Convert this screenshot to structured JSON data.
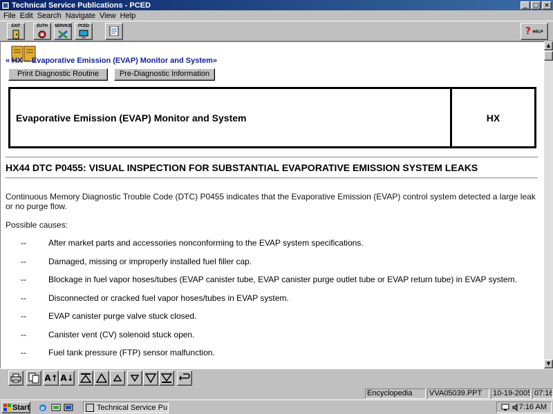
{
  "window": {
    "title": "Technical Service Publications - PCED",
    "controls": [
      "_",
      "□",
      "×"
    ]
  },
  "menu": [
    {
      "label": "File"
    },
    {
      "label": "Edit"
    },
    {
      "label": "Search"
    },
    {
      "label": "Navigate"
    },
    {
      "label": "View"
    },
    {
      "label": "Help"
    }
  ],
  "toolbar": {
    "exit_label": "EXIT",
    "euth_label": "EUTH",
    "service_label": "SERVICE",
    "pced_label": "PCED",
    "help_label": "HELP"
  },
  "document": {
    "breadcrumb": "«   HX   --   Evaporative Emission (EVAP) Monitor and System»",
    "print_button": "Print Diagnostic Routine",
    "prediag_button": "Pre-Diagnostic Information",
    "title": "Evaporative Emission (EVAP) Monitor and System",
    "code": "HX",
    "heading": "HX44 DTC P0455: VISUAL INSPECTION FOR SUBSTANTIAL EVAPORATIVE EMISSION SYSTEM LEAKS",
    "intro": "Continuous Memory Diagnostic Trouble Code (DTC) P0455 indicates that the Evaporative Emission (EVAP) control system detected a large leak or no purge flow.",
    "causes_label": "Possible causes:",
    "dash": "--",
    "causes": [
      "After market parts and accessories nonconforming to the EVAP system specifications.",
      "Damaged, missing or improperly installed fuel filler cap.",
      "Blockage in fuel vapor hoses/tubes (EVAP canister tube, EVAP canister purge outlet tube or EVAP return tube) in EVAP system.",
      "Disconnected or cracked fuel vapor hoses/tubes in EVAP system.",
      "EVAP canister purge valve stuck closed.",
      "Canister vent (CV) solenoid stuck open.",
      "Fuel tank pressure (FTP) sensor malfunction."
    ]
  },
  "nav": {
    "font_up": "A↑",
    "font_down": "A↓"
  },
  "status": {
    "section": "Encyclopedia",
    "file": "VVA05039.PPT",
    "date": "10-19-2005",
    "time": "07:16"
  },
  "taskbar": {
    "start_label": "Start",
    "task_label": "Technical Service Pu...",
    "clock": "7:16 AM"
  },
  "colors": {
    "title_gradient_start": "#0a246a",
    "title_gradient_end": "#3a6ea5",
    "breadcrumb": "#1020a0",
    "help_icon": "#d01010"
  }
}
